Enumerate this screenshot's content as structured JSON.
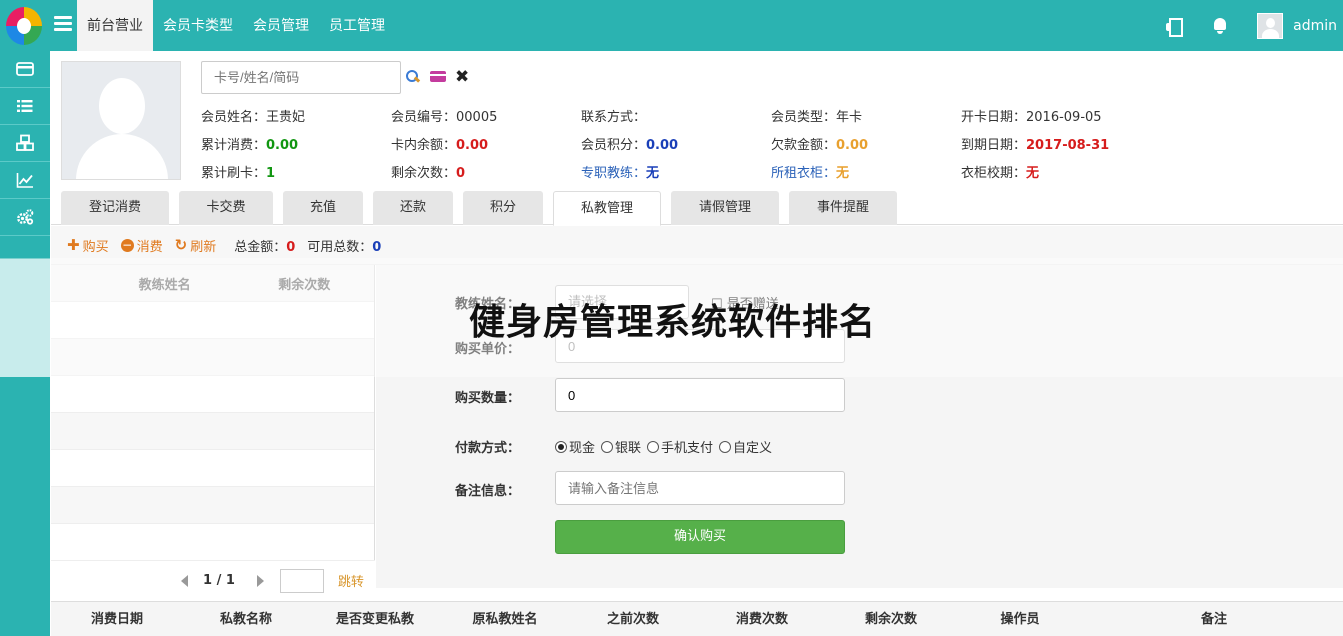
{
  "topbar": {
    "nav": [
      "前台营业",
      "会员卡类型",
      "会员管理",
      "员工管理"
    ],
    "active_nav": 0,
    "username": "admin"
  },
  "sidebar": {
    "icons": [
      "credit-card-icon",
      "list-icon",
      "cubes-icon",
      "line-chart-icon",
      "gears-icon"
    ]
  },
  "search": {
    "placeholder": "卡号/姓名/简码"
  },
  "member": {
    "rows": [
      [
        {
          "label": "会员姓名：",
          "value": "王贵妃",
          "style": "plain"
        },
        {
          "label": "会员编号：",
          "value": "00005",
          "style": "plain"
        },
        {
          "label": "联系方式：",
          "value": "",
          "style": "plain"
        },
        {
          "label": "会员类型：",
          "value": "年卡",
          "style": "plain"
        },
        {
          "label": "开卡日期：",
          "value": "2016-09-05",
          "style": "plain"
        }
      ],
      [
        {
          "label": "累计消费：",
          "value": "0.00",
          "style": "green"
        },
        {
          "label": "卡内余额：",
          "value": "0.00",
          "style": "red"
        },
        {
          "label": "会员积分：",
          "value": "0.00",
          "style": "blue"
        },
        {
          "label": "欠款金额：",
          "value": "0.00",
          "style": "orange"
        },
        {
          "label": "到期日期：",
          "value": "2017-08-31",
          "style": "red"
        }
      ],
      [
        {
          "label": "累计刷卡：",
          "value": "1",
          "style": "green"
        },
        {
          "label": "剩余次数：",
          "value": "0",
          "style": "red"
        },
        {
          "label": "专职教练：",
          "value": "无",
          "style": "blue",
          "label_blue": true
        },
        {
          "label": "所租衣柜：",
          "value": "无",
          "style": "orange",
          "label_blue": true
        },
        {
          "label": "衣柜校期：",
          "value": "无",
          "style": "red"
        }
      ]
    ]
  },
  "tabs": [
    "登记消费",
    "卡交费",
    "充值",
    "还款",
    "积分",
    "私教管理",
    "请假管理",
    "事件提醒"
  ],
  "active_tab": 5,
  "actions": {
    "buy": "购买",
    "consume": "消费",
    "refresh": "刷新",
    "total_amount_label": "总金额：",
    "total_amount": "0",
    "available_label": "可用总数：",
    "available": "0"
  },
  "coach_table": {
    "headers": [
      "教练姓名",
      "剩余次数"
    ],
    "page": "1 / 1",
    "jump": "跳转"
  },
  "form": {
    "coach_label": "教练姓名：",
    "coach_select": "请选择",
    "gift_label": "是否赠送",
    "price_label": "购买单价：",
    "price_value": "0",
    "qty_label": "购买数量：",
    "qty_value": "0",
    "pay_label": "付款方式：",
    "pay_options": [
      "现金",
      "银联",
      "手机支付",
      "自定义"
    ],
    "pay_selected": 0,
    "note_label": "备注信息：",
    "note_placeholder": "请输入备注信息",
    "confirm": "确认购买"
  },
  "banner": {
    "text": "健身房管理系统软件排名"
  },
  "bottom_table": {
    "headers": [
      "消费日期",
      "私教名称",
      "是否变更私教",
      "原私教姓名",
      "之前次数",
      "消费次数",
      "剩余次数",
      "操作员",
      "备注"
    ]
  }
}
